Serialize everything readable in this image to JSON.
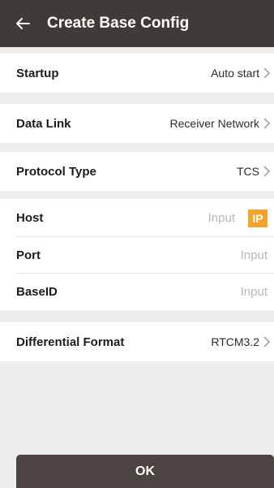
{
  "header": {
    "title": "Create Base Config"
  },
  "startup": {
    "label": "Startup",
    "value": "Auto start"
  },
  "data_link": {
    "label": "Data Link",
    "value": "Receiver Network"
  },
  "protocol_type": {
    "label": "Protocol Type",
    "value": "TCS"
  },
  "host": {
    "label": "Host",
    "placeholder": "Input",
    "badge": "IP"
  },
  "port": {
    "label": "Port",
    "placeholder": "Input"
  },
  "base_id": {
    "label": "BaseID",
    "placeholder": "Input"
  },
  "differential_format": {
    "label": "Differential Format",
    "value": "RTCM3.2"
  },
  "footer": {
    "ok_label": "OK"
  },
  "colors": {
    "header_bg": "#413b38",
    "accent": "#f3a22c",
    "button_bg": "#4b4441"
  },
  "icons": {
    "back": "back-arrow-icon",
    "chevron": "chevron-right-icon"
  }
}
